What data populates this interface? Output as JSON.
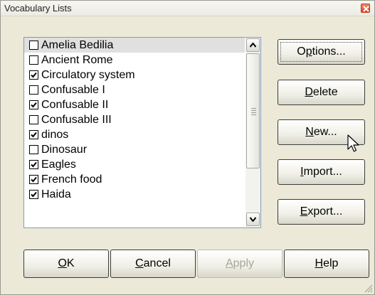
{
  "window": {
    "title": "Vocabulary Lists"
  },
  "list": {
    "items": [
      {
        "label": "Amelia Bedilia",
        "checked": false
      },
      {
        "label": "Ancient Rome",
        "checked": false
      },
      {
        "label": "Circulatory system",
        "checked": true
      },
      {
        "label": "Confusable I",
        "checked": false
      },
      {
        "label": "Confusable II",
        "checked": true
      },
      {
        "label": "Confusable III",
        "checked": false
      },
      {
        "label": "dinos",
        "checked": true
      },
      {
        "label": "Dinosaur",
        "checked": false
      },
      {
        "label": "Eagles",
        "checked": true
      },
      {
        "label": "French food",
        "checked": true
      },
      {
        "label": "Haida",
        "checked": true
      }
    ]
  },
  "side_buttons": {
    "options": {
      "pre": "O",
      "accel": "p",
      "post": "tions..."
    },
    "delete": {
      "pre": "",
      "accel": "D",
      "post": "elete"
    },
    "new": {
      "pre": "",
      "accel": "N",
      "post": "ew..."
    },
    "import": {
      "pre": "",
      "accel": "I",
      "post": "mport..."
    },
    "export": {
      "pre": "",
      "accel": "E",
      "post": "xport..."
    }
  },
  "bottom_buttons": {
    "ok": {
      "accel": "O",
      "post": "K"
    },
    "cancel": {
      "accel": "C",
      "post": "ancel"
    },
    "apply": {
      "accel": "A",
      "post": "pply",
      "enabled": false
    },
    "help": {
      "accel": "H",
      "post": "elp"
    }
  },
  "colors": {
    "face": "#ece9d8",
    "list_border": "#7f9db9",
    "disabled_text": "#a6a69c"
  },
  "icons": [
    "close-icon",
    "checkbox-icon",
    "scroll-up-arrow-icon",
    "scroll-down-arrow-icon",
    "mouse-pointer-icon",
    "resize-grip-icon"
  ]
}
